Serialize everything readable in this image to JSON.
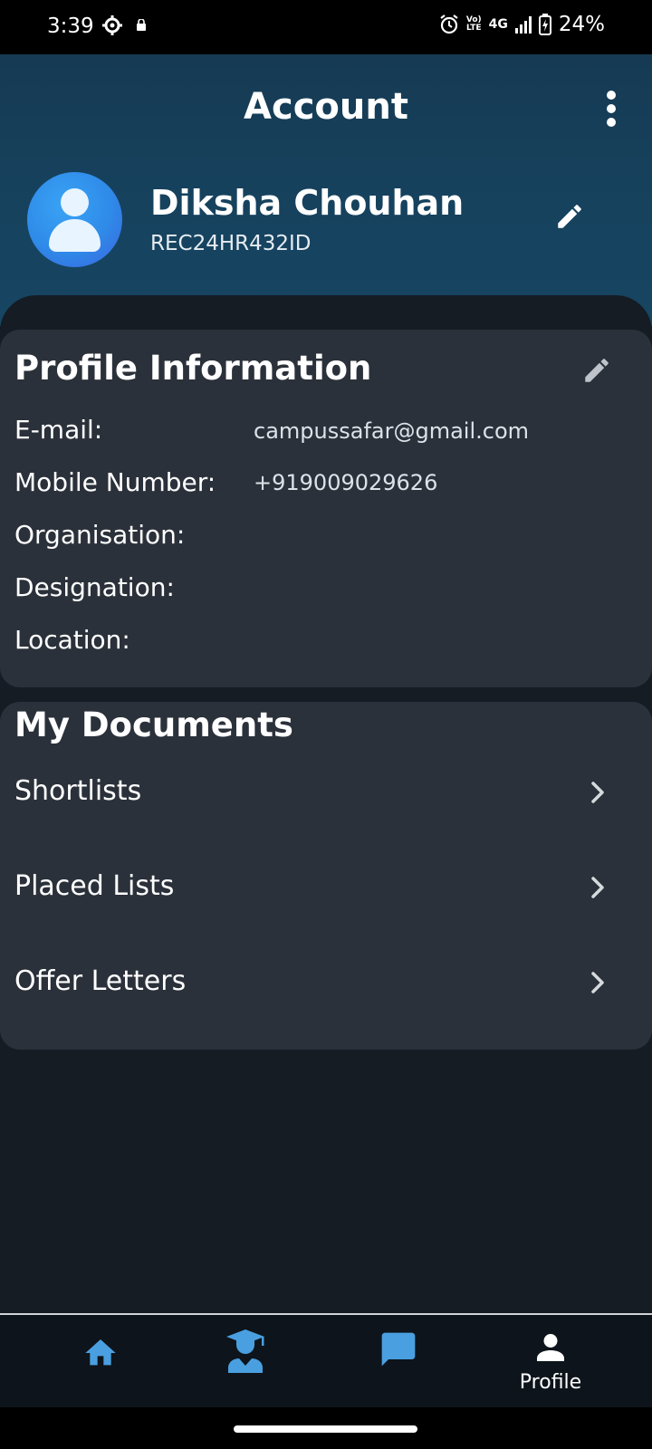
{
  "status_bar": {
    "time": "3:39",
    "network": "4G",
    "volte_line1": "Vo)",
    "volte_line2": "LTE",
    "battery": "24%"
  },
  "header": {
    "title": "Account"
  },
  "user": {
    "name": "Diksha Chouhan",
    "id": "REC24HR432ID"
  },
  "profile_info": {
    "title": "Profile Information",
    "fields": [
      {
        "label": "E-mail:",
        "value": "campussafar@gmail.com"
      },
      {
        "label": "Mobile Number:",
        "value": "+919009029626"
      },
      {
        "label": "Organisation:",
        "value": ""
      },
      {
        "label": "Designation:",
        "value": ""
      },
      {
        "label": "Location:",
        "value": ""
      }
    ]
  },
  "documents": {
    "title": "My Documents",
    "items": [
      {
        "label": "Shortlists"
      },
      {
        "label": "Placed Lists"
      },
      {
        "label": "Offer Letters"
      }
    ]
  },
  "bottom_nav": {
    "items": [
      {
        "icon": "home-icon",
        "label": ""
      },
      {
        "icon": "graduate-icon",
        "label": ""
      },
      {
        "icon": "chat-icon",
        "label": ""
      },
      {
        "icon": "person-icon",
        "label": "Profile",
        "active": true
      }
    ],
    "accent_color": "#4a9fe0"
  },
  "colors": {
    "header_bg": "#163a53",
    "card_bg": "#2b313a",
    "page_bg": "#151c24",
    "avatar_blue": "#2f8ae8"
  }
}
